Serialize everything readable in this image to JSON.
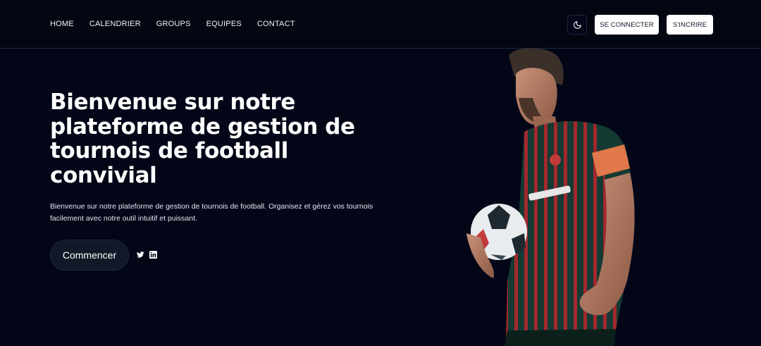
{
  "nav": {
    "links": [
      "HOME",
      "CALENDRIER",
      "GROUPS",
      "EQUIPES",
      "CONTACT"
    ],
    "theme_icon": "moon-icon",
    "login_label": "SE CONNECTER",
    "signup_label": "S'INCRIRE"
  },
  "hero": {
    "title": "Bienvenue sur notre plateforme de gestion de tournois de football  convivial",
    "description": "Bienvenue sur notre plateforme de gestion de tournois de football. Organisez et gérez vos tournois facilement avec notre outil intuitif et puissant.",
    "cta_label": "Commencer",
    "social_icons": [
      "twitter-icon",
      "linkedin-icon"
    ],
    "image_icon": "football-player-image"
  },
  "colors": {
    "background": "#020617",
    "nav_background": "#030712",
    "button_dark": "#111827",
    "button_light": "#ffffff"
  }
}
